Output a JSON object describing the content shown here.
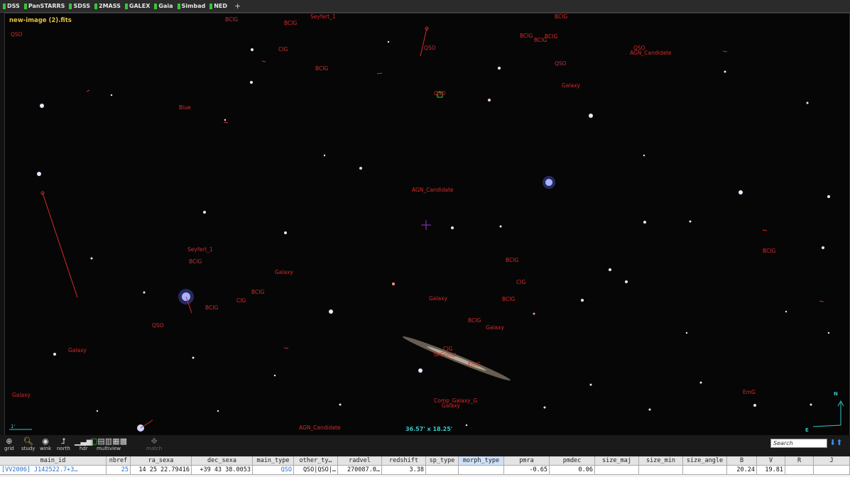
{
  "topbar": {
    "surveys": [
      "DSS",
      "PanSTARRS",
      "SDSS",
      "2MASS",
      "GALEX",
      "Gaia",
      "Simbad",
      "NED"
    ],
    "add_label": "+"
  },
  "view": {
    "filename": "new-image (2).fits",
    "fov_label": "36.57' x 18.25'",
    "scale_label": "1'",
    "compass_n": "N",
    "compass_e": "E"
  },
  "labels": [
    {
      "text": "QSO"
    },
    {
      "text": "BCIG"
    },
    {
      "text": "BCIG"
    },
    {
      "text": "Seyfert_1"
    },
    {
      "text": "QSO"
    },
    {
      "text": "BCIG"
    },
    {
      "text": "BCIG"
    },
    {
      "text": "BCIG"
    },
    {
      "text": "CIG"
    },
    {
      "text": "QSO"
    },
    {
      "text": "AGN_Candidate"
    },
    {
      "text": "BCIG"
    },
    {
      "text": "QSO"
    },
    {
      "text": "Galaxy"
    },
    {
      "text": "QSO"
    },
    {
      "text": "Blue"
    },
    {
      "text": "AGN_Candidate"
    },
    {
      "text": "Seyfert_1"
    },
    {
      "text": "BCIG"
    },
    {
      "text": "BCIG"
    },
    {
      "text": "BCIG"
    },
    {
      "text": "Galaxy"
    },
    {
      "text": "CIG"
    },
    {
      "text": "BCIG"
    },
    {
      "text": "CIG"
    },
    {
      "text": "BCIG"
    },
    {
      "text": "Galaxy"
    },
    {
      "text": "BCIG"
    },
    {
      "text": "BCIG"
    },
    {
      "text": "QSO"
    },
    {
      "text": "Galaxy"
    },
    {
      "text": "Galaxy"
    },
    {
      "text": "CIG"
    },
    {
      "text": "GrGroup"
    },
    {
      "text": "EmG"
    },
    {
      "text": "Galaxy"
    },
    {
      "text": "Comp_Galaxy_G"
    },
    {
      "text": "Galaxy"
    },
    {
      "text": "EmG"
    },
    {
      "text": "AGN_Candidate"
    },
    {
      "text": "BCIG"
    }
  ],
  "tools": [
    {
      "label": "grid",
      "icon": "grid-icon"
    },
    {
      "label": "study",
      "icon": "study-icon"
    },
    {
      "label": "wink",
      "icon": "eye-icon"
    },
    {
      "label": "north",
      "icon": "north-icon"
    },
    {
      "label": "hdr",
      "icon": "hdr-icon"
    },
    {
      "label": "multiview",
      "icon": "multiview-icon"
    },
    {
      "label": "match",
      "icon": "match-icon"
    }
  ],
  "search": {
    "placeholder": "Search"
  },
  "table": {
    "columns": [
      "main_id",
      "nbref",
      "ra_sexa",
      "dec_sexa",
      "main_type",
      "other_ty…",
      "radvel",
      "redshift",
      "sp_type",
      "morph_type",
      "pmra",
      "pmdec",
      "size_maj",
      "size_min",
      "size_angle",
      "B",
      "V",
      "R",
      "J"
    ],
    "highlight_column": "morph_type",
    "row": [
      "[VV2006] J142522.7+3…",
      "25",
      "14 25 22.79416",
      "+39 43 38.0053",
      "QSO",
      "QSO|QSO|…",
      "270087.0…",
      "3.38",
      "",
      "",
      "-0.65",
      "0.06",
      "",
      "",
      "",
      "20.24",
      "19.81",
      "",
      ""
    ]
  }
}
